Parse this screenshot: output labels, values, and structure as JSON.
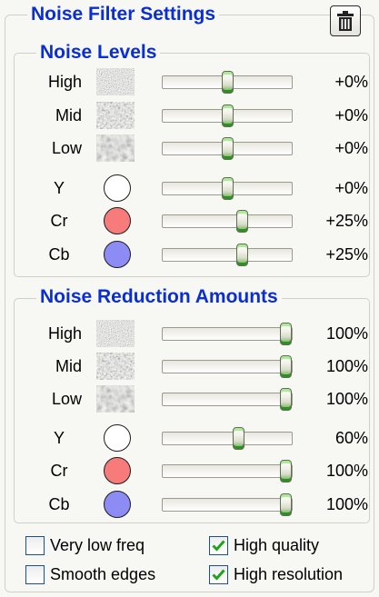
{
  "window": {
    "title": "Noise Filter Settings",
    "delete_icon": "trash-can-icon"
  },
  "noise_levels": {
    "title": "Noise Levels",
    "rows": [
      {
        "label": "High",
        "indicator": "noise-high-texture",
        "value": 0,
        "value_text": "+0%"
      },
      {
        "label": "Mid",
        "indicator": "noise-mid-texture",
        "value": 0,
        "value_text": "+0%"
      },
      {
        "label": "Low",
        "indicator": "noise-low-texture",
        "value": 0,
        "value_text": "+0%"
      },
      {
        "label": "Y",
        "indicator": "color-circle",
        "color": "#ffffff",
        "value": 0,
        "value_text": "+0%"
      },
      {
        "label": "Cr",
        "indicator": "color-circle",
        "color": "#f77b7b",
        "value": 25,
        "value_text": "+25%"
      },
      {
        "label": "Cb",
        "indicator": "color-circle",
        "color": "#8c8cf4",
        "value": 25,
        "value_text": "+25%"
      }
    ],
    "range": [
      -100,
      100
    ]
  },
  "noise_reduction": {
    "title": "Noise Reduction Amounts",
    "rows": [
      {
        "label": "High",
        "indicator": "noise-high-texture",
        "value": 100,
        "value_text": "100%"
      },
      {
        "label": "Mid",
        "indicator": "noise-mid-texture",
        "value": 100,
        "value_text": "100%"
      },
      {
        "label": "Low",
        "indicator": "noise-low-texture",
        "value": 100,
        "value_text": "100%"
      },
      {
        "label": "Y",
        "indicator": "color-circle",
        "color": "#ffffff",
        "value": 60,
        "value_text": "60%"
      },
      {
        "label": "Cr",
        "indicator": "color-circle",
        "color": "#f77b7b",
        "value": 100,
        "value_text": "100%"
      },
      {
        "label": "Cb",
        "indicator": "color-circle",
        "color": "#8c8cf4",
        "value": 100,
        "value_text": "100%"
      }
    ],
    "range": [
      0,
      100
    ]
  },
  "options": [
    {
      "label": "Very low freq",
      "checked": false
    },
    {
      "label": "High quality",
      "checked": true
    },
    {
      "label": "Smooth edges",
      "checked": false
    },
    {
      "label": "High resolution",
      "checked": true
    }
  ],
  "colors": {
    "title_blue": "#0a2ed6",
    "slider_green": "#3e9b2d",
    "check_green": "#21a121"
  }
}
